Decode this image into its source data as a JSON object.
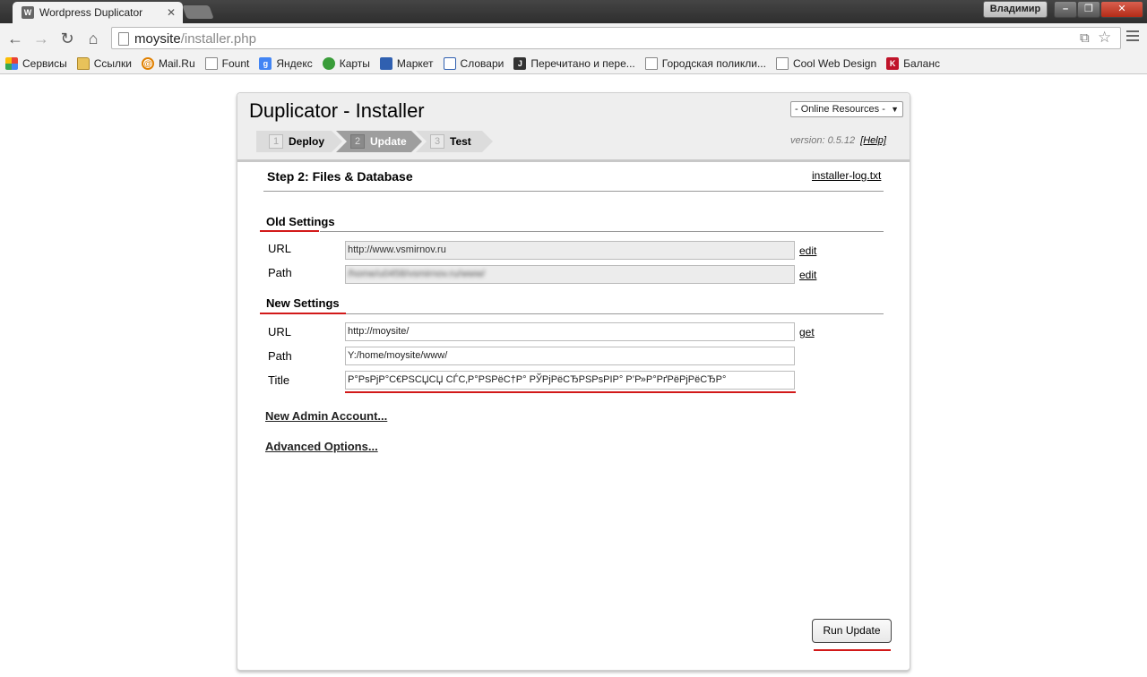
{
  "browser": {
    "tab_title": "Wordpress Duplicator",
    "tab_close": "✕",
    "user_name": "Владимир",
    "win_min": "–",
    "win_max": "❐",
    "win_close": "✕",
    "url_host": "moysite",
    "url_path": "/installer.php",
    "bookmarks": [
      {
        "label": "Сервисы",
        "icon": "apps-grid-icon"
      },
      {
        "label": "Ссылки",
        "icon": "folder-icon"
      },
      {
        "label": "Mail.Ru",
        "icon": "mailru-icon"
      },
      {
        "label": "Fount",
        "icon": "page-icon"
      },
      {
        "label": "Яндекс",
        "icon": "google-icon"
      },
      {
        "label": "Карты",
        "icon": "maps-icon"
      },
      {
        "label": "Маркет",
        "icon": "market-icon"
      },
      {
        "label": "Словари",
        "icon": "dictionary-icon"
      },
      {
        "label": "Перечитано и пере...",
        "icon": "j-icon"
      },
      {
        "label": "Городская поликли...",
        "icon": "page-icon"
      },
      {
        "label": "Cool Web Design",
        "icon": "page-icon"
      },
      {
        "label": "Баланс",
        "icon": "k-icon"
      }
    ]
  },
  "installer": {
    "title": "Duplicator - Installer",
    "resources_select": "- Online Resources -",
    "steps": [
      {
        "num": "1",
        "label": "Deploy"
      },
      {
        "num": "2",
        "label": "Update"
      },
      {
        "num": "3",
        "label": "Test"
      }
    ],
    "version": "version: 0.5.12",
    "help": "[Help]",
    "step_heading": "Step 2: Files & Database",
    "log_link": "installer-log.txt",
    "old_settings": {
      "title": "Old Settings",
      "url_label": "URL",
      "url_value": "http://www.vsmirnov.ru",
      "url_link": "edit",
      "path_label": "Path",
      "path_value": "/home/u0458/vsmirnov.ru/www/",
      "path_link": "edit"
    },
    "new_settings": {
      "title": "New Settings",
      "url_label": "URL",
      "url_value": "http://moysite/",
      "url_link": "get",
      "path_label": "Path",
      "path_value": "Y:/home/moysite/www/",
      "title_label": "Title",
      "title_value": "Р°РѕРјР°С€РЅСЏСЏ СЃС‚Р°РЅРёС†Р° РЎРјРёСЂРЅРѕРІР° Р’Р»Р°РґРёРјРёСЂР°"
    },
    "new_admin_link": "New Admin Account...",
    "advanced_link": "Advanced Options...",
    "run_button": "Run Update"
  },
  "colors": {
    "annotation_red": "#d21919"
  }
}
